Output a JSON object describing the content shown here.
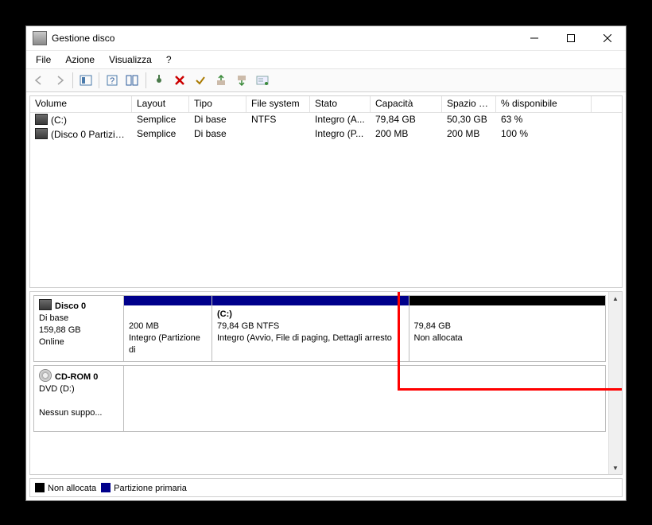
{
  "window": {
    "title": "Gestione disco"
  },
  "menu": {
    "file": "File",
    "azione": "Azione",
    "visualizza": "Visualizza",
    "help": "?"
  },
  "columns": [
    "Volume",
    "Layout",
    "Tipo",
    "File system",
    "Stato",
    "Capacità",
    "Spazio d...",
    "% disponibile"
  ],
  "volumes": [
    {
      "name": "(C:)",
      "layout": "Semplice",
      "tipo": "Di base",
      "fs": "NTFS",
      "stato": "Integro (A...",
      "cap": "79,84 GB",
      "spazio": "50,30 GB",
      "pct": "63 %"
    },
    {
      "name": "(Disco 0 Partizione...",
      "layout": "Semplice",
      "tipo": "Di base",
      "fs": "",
      "stato": "Integro (P...",
      "cap": "200 MB",
      "spazio": "200 MB",
      "pct": "100 %"
    }
  ],
  "disk0": {
    "title": "Disco 0",
    "type": "Di base",
    "size": "159,88 GB",
    "status": "Online",
    "parts": [
      {
        "bar_color": "#00008b",
        "title": "",
        "size": "200 MB",
        "detail": "Integro (Partizione di"
      },
      {
        "bar_color": "#00008b",
        "title": "(C:)",
        "size": "79,84 GB NTFS",
        "detail": "Integro (Avvio, File di paging, Dettagli arresto"
      },
      {
        "bar_color": "#000000",
        "title": "",
        "size": "79,84 GB",
        "detail": "Non allocata"
      }
    ]
  },
  "cdrom": {
    "title": "CD-ROM 0",
    "dev": "DVD (D:)",
    "msg": "Nessun suppo..."
  },
  "legend": {
    "unalloc": "Non allocata",
    "primary": "Partizione primaria",
    "color_unalloc": "#000000",
    "color_primary": "#00008b"
  }
}
